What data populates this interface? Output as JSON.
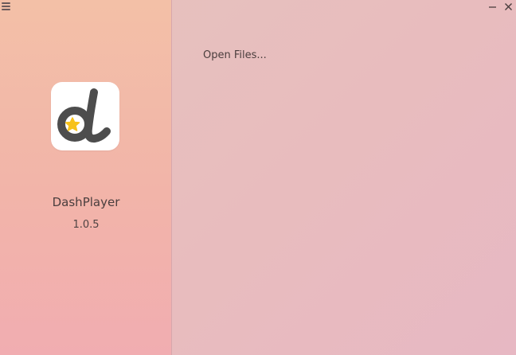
{
  "app": {
    "name": "DashPlayer",
    "version": "1.0.5"
  },
  "main": {
    "open_files_label": "Open Files..."
  },
  "icons": {
    "menu": "hamburger-menu-icon",
    "minimize": "minimize-icon",
    "close": "close-icon",
    "logo": "dashplayer-logo-icon"
  },
  "colors": {
    "sidebar_top": "#f3c0a7",
    "sidebar_bottom": "#f1adb1",
    "main_bg": "#e8bcbe",
    "logo_glyph": "#4d4d4d",
    "logo_star": "#f7c21b",
    "text": "#4a3e3e"
  }
}
